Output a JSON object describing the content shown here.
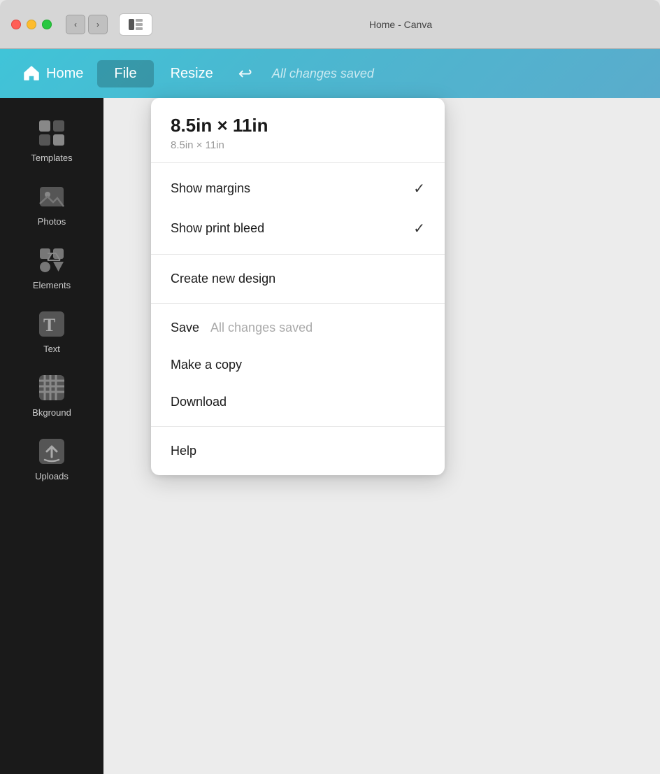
{
  "window": {
    "title": "Home - Canva",
    "traffic_lights": {
      "close": "close",
      "minimize": "minimize",
      "maximize": "maximize"
    }
  },
  "header": {
    "home_label": "Home",
    "file_label": "File",
    "resize_label": "Resize",
    "undo_symbol": "↩",
    "saved_status": "All changes saved"
  },
  "sidebar": {
    "items": [
      {
        "id": "templates",
        "label": "Templates",
        "icon": "templates"
      },
      {
        "id": "photos",
        "label": "Photos",
        "icon": "photos"
      },
      {
        "id": "elements",
        "label": "Elements",
        "icon": "elements"
      },
      {
        "id": "text",
        "label": "Text",
        "icon": "text"
      },
      {
        "id": "background",
        "label": "Bkground",
        "icon": "background"
      },
      {
        "id": "uploads",
        "label": "Uploads",
        "icon": "uploads"
      }
    ]
  },
  "file_menu": {
    "size_title": "8.5in × 11in",
    "size_subtitle": "8.5in × 11in",
    "items": [
      {
        "id": "show-margins",
        "label": "Show margins",
        "checked": true
      },
      {
        "id": "show-print-bleed",
        "label": "Show print bleed",
        "checked": true
      }
    ],
    "actions": [
      {
        "id": "create-new-design",
        "label": "Create new design"
      },
      {
        "id": "save",
        "label": "Save",
        "status": "All changes saved"
      },
      {
        "id": "make-a-copy",
        "label": "Make a copy"
      },
      {
        "id": "download",
        "label": "Download"
      },
      {
        "id": "help",
        "label": "Help"
      }
    ]
  }
}
